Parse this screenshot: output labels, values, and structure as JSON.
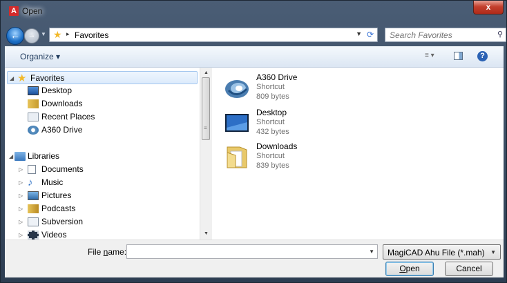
{
  "window": {
    "title": "Open",
    "app_icon_letter": "A",
    "close_glyph": "x"
  },
  "navbar": {
    "back_glyph": "←",
    "forward_glyph": "→",
    "breadcrumb_separator": "▸",
    "breadcrumb": "Favorites",
    "refresh_glyph": "⟳",
    "search_placeholder": "Search Favorites"
  },
  "toolbar": {
    "organize_label": "Organize ▾",
    "views_glyph": "≡ ▾",
    "help_glyph": "?"
  },
  "nav_tree": {
    "favorites": {
      "label": "Favorites",
      "items": [
        {
          "label": "Desktop"
        },
        {
          "label": "Downloads"
        },
        {
          "label": "Recent Places"
        },
        {
          "label": "A360 Drive"
        }
      ]
    },
    "libraries": {
      "label": "Libraries",
      "items": [
        {
          "label": "Documents"
        },
        {
          "label": "Music"
        },
        {
          "label": "Pictures"
        },
        {
          "label": "Podcasts"
        },
        {
          "label": "Subversion"
        },
        {
          "label": "Videos"
        }
      ]
    }
  },
  "files": [
    {
      "name": "A360 Drive",
      "type": "Shortcut",
      "size": "809 bytes"
    },
    {
      "name": "Desktop",
      "type": "Shortcut",
      "size": "432 bytes"
    },
    {
      "name": "Downloads",
      "type": "Shortcut",
      "size": "839 bytes"
    }
  ],
  "bottom": {
    "file_name_label_pre": "File ",
    "file_name_label_key": "n",
    "file_name_label_post": "ame:",
    "file_name_value": "",
    "file_type_value": "MagiCAD Ahu File (*.mah)",
    "open_label_key": "O",
    "open_label_rest": "pen",
    "cancel_label": "Cancel"
  }
}
